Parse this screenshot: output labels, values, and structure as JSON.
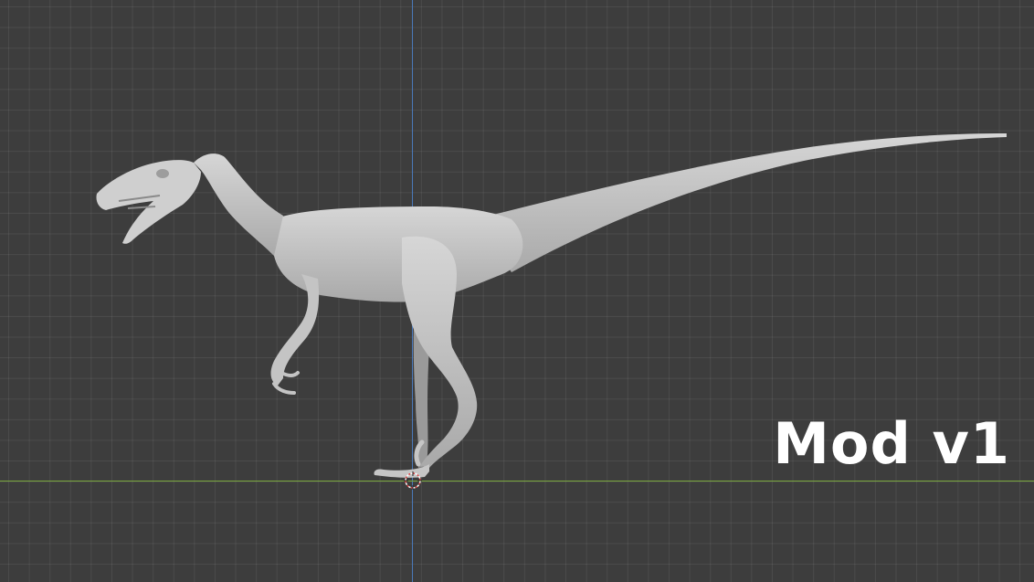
{
  "viewport": {
    "background_color": "#3d3d3d",
    "grid_color": "#4a4a4a",
    "axis_z_color": "#4a78b8",
    "axis_y_color": "#7aa83e",
    "model_color": "#cbcbcb"
  },
  "object": {
    "icon": "raptor-model"
  },
  "cursor": {
    "icon": "3d-cursor-icon"
  },
  "overlay": {
    "label": "Mod v1",
    "color": "#ffffff"
  }
}
